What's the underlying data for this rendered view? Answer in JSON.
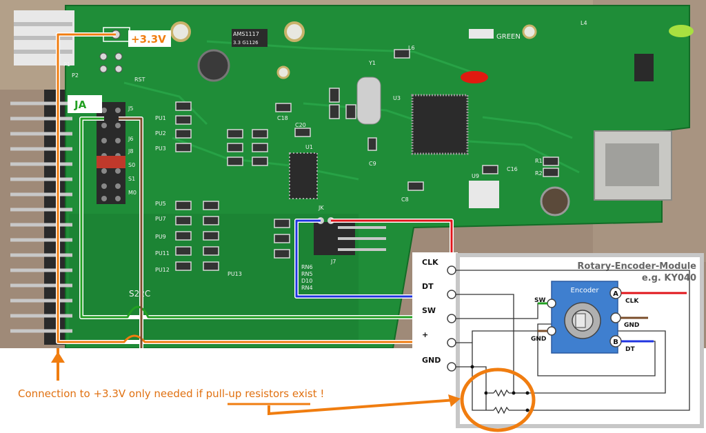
{
  "labels": {
    "v33": "+3.3V",
    "ja": "JA",
    "module_title": "Rotary-Encoder-Module",
    "module_subtitle": "e.g. KY040",
    "encoder": "Encoder",
    "pin_clk": "CLK",
    "pin_dt": "DT",
    "pin_sw": "SW",
    "pin_plus": "+",
    "pin_gnd": "GND",
    "enc_sw": "SW",
    "enc_gnd_left": "GND",
    "enc_a": "A",
    "enc_b": "B",
    "enc_clk": "CLK",
    "enc_gnd_right": "GND",
    "enc_dt": "DT",
    "note_prefix": "Connection to +3.3V  only needed if ",
    "note_highlight": "pull-up resistors",
    "note_suffix": " exist !"
  },
  "board_silk": {
    "green_led": "GREEN",
    "reg": "AMS1117",
    "regsub": "3.3 G1126",
    "p1": "P1",
    "p2": "P2",
    "rst": "RST",
    "j5": "J5",
    "j6": "J6",
    "j8": "J8",
    "s0": "S0",
    "s1": "S1",
    "m0": "M0",
    "u1": "U1",
    "u3": "U3",
    "u9": "U9",
    "y1": "Y1",
    "jk": "JK",
    "j7": "J7",
    "c8": "C8",
    "c9": "C9",
    "c16": "C16",
    "c18": "C18",
    "c20": "C20",
    "pu5": "PU5",
    "pu7": "PU7",
    "pu9": "PU9",
    "pu11": "PU11",
    "pu12": "PU12",
    "pu13": "PU13",
    "pu1": "PU1",
    "pu2": "PU2",
    "pu3": "PU3",
    "r1": "R1",
    "r2": "R2",
    "l4": "L4",
    "l6": "L6",
    "rn6": "RN6",
    "rn5": "RN5",
    "rn4": "RN4",
    "d10": "D10",
    "s22c": "S22C"
  },
  "colors": {
    "orange": "#f07d10",
    "green": "#22a022",
    "blue": "#1f33e0",
    "red": "#e0141a",
    "brown": "#7a4d2a",
    "white_wire": "#ffffff",
    "pcb": "#1f8d38",
    "module_border": "#c7c7c7",
    "encoder_board": "#3f7fcf"
  }
}
